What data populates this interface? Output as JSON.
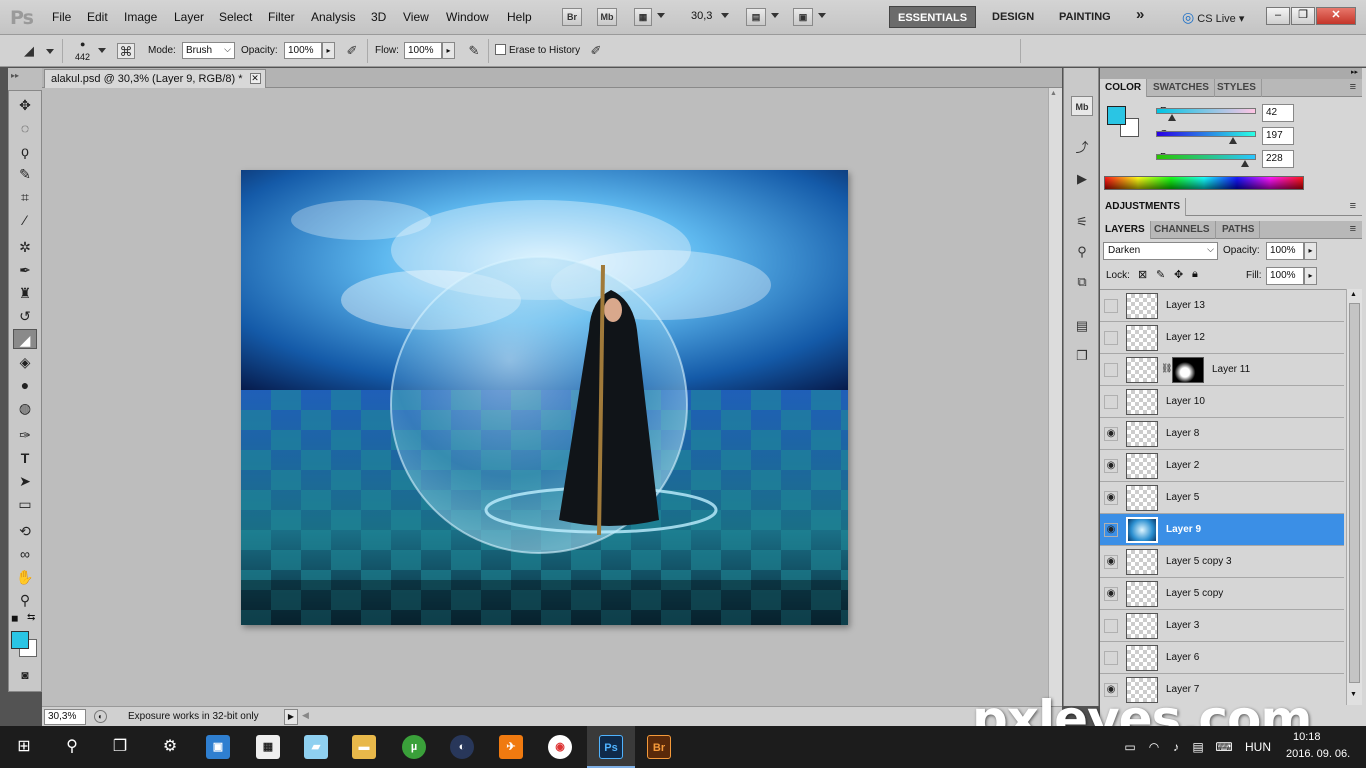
{
  "app": {
    "logo": "Ps",
    "menus": [
      "File",
      "Edit",
      "Image",
      "Layer",
      "Select",
      "Filter",
      "Analysis",
      "3D",
      "View",
      "Window",
      "Help"
    ],
    "bridge_label": "Br",
    "minibridge_label": "Mb",
    "zoom_value": "30,3",
    "workspaces": [
      "ESSENTIALS",
      "DESIGN",
      "PAINTING"
    ],
    "more_workspaces": "»",
    "cs_live": "CS Live"
  },
  "options": {
    "brush_size": "442",
    "mode_label": "Mode:",
    "mode_value": "Brush",
    "opacity_label": "Opacity:",
    "opacity_value": "100%",
    "flow_label": "Flow:",
    "flow_value": "100%",
    "erase_history_label": "Erase to History"
  },
  "document": {
    "tab_title": "alakul.psd @ 30,3% (Layer 9, RGB/8) *",
    "zoom_status": "30,3%",
    "status_text": "Exposure works in 32-bit only"
  },
  "color_panel": {
    "tabs": [
      "COLOR",
      "SWATCHES",
      "STYLES"
    ],
    "r_label": "R",
    "g_label": "G",
    "b_label": "B",
    "r": 42,
    "g": 197,
    "b": 228,
    "foreground": "#2ac5e4",
    "background": "#ffffff"
  },
  "adjustments": {
    "title": "ADJUSTMENTS"
  },
  "layers_panel": {
    "tabs": [
      "LAYERS",
      "CHANNELS",
      "PATHS"
    ],
    "blend_mode": "Darken",
    "opacity_label": "Opacity:",
    "opacity": "100%",
    "lock_label": "Lock:",
    "fill_label": "Fill:",
    "fill": "100%",
    "layers": [
      {
        "name": "Layer 13",
        "visible": false,
        "selected": false
      },
      {
        "name": "Layer 12",
        "visible": false,
        "selected": false
      },
      {
        "name": "Layer 11",
        "visible": false,
        "selected": false
      },
      {
        "name": "Layer 10",
        "visible": false,
        "selected": false
      },
      {
        "name": "Layer 8",
        "visible": true,
        "selected": false
      },
      {
        "name": "Layer 2",
        "visible": true,
        "selected": false
      },
      {
        "name": "Layer 5",
        "visible": true,
        "selected": false
      },
      {
        "name": "Layer 9",
        "visible": true,
        "selected": true
      },
      {
        "name": "Layer 5 copy 3",
        "visible": true,
        "selected": false
      },
      {
        "name": "Layer 5 copy",
        "visible": true,
        "selected": false
      },
      {
        "name": "Layer 3",
        "visible": false,
        "selected": false
      },
      {
        "name": "Layer 6",
        "visible": false,
        "selected": false
      },
      {
        "name": "Layer 7",
        "visible": true,
        "selected": false
      }
    ]
  },
  "watermark": "pxleyes.com",
  "taskbar": {
    "language": "HUN",
    "time": "10:18",
    "date": "2016. 09. 06.",
    "ps_label": "Ps",
    "br_label": "Br"
  },
  "colors": {
    "selection": "#3b8fe6",
    "accent_cyan": "#2ac5e4"
  }
}
